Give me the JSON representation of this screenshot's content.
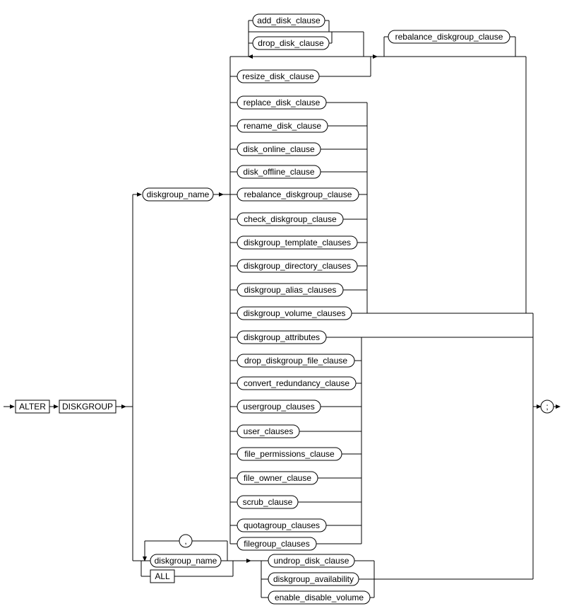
{
  "diagram": {
    "type": "railroad_syntax_diagram",
    "statement": "ALTER DISKGROUP",
    "keywords": {
      "alter": "ALTER",
      "diskgroup": "DISKGROUP",
      "all": "ALL",
      "semicolon": ";",
      "comma": ","
    },
    "nonterminals": {
      "diskgroup_name_1": "diskgroup_name",
      "diskgroup_name_2": "diskgroup_name",
      "add_disk_clause": "add_disk_clause",
      "drop_disk_clause": "drop_disk_clause",
      "resize_disk_clause": "resize_disk_clause",
      "rebalance_diskgroup_clause_top": "rebalance_diskgroup_clause",
      "replace_disk_clause": "replace_disk_clause",
      "rename_disk_clause": "rename_disk_clause",
      "disk_online_clause": "disk_online_clause",
      "disk_offline_clause": "disk_offline_clause",
      "rebalance_diskgroup_clause": "rebalance_diskgroup_clause",
      "check_diskgroup_clause": "check_diskgroup_clause",
      "diskgroup_template_clauses": "diskgroup_template_clauses",
      "diskgroup_directory_clauses": "diskgroup_directory_clauses",
      "diskgroup_alias_clauses": "diskgroup_alias_clauses",
      "diskgroup_volume_clauses": "diskgroup_volume_clauses",
      "diskgroup_attributes": "diskgroup_attributes",
      "drop_diskgroup_file_clause": "drop_diskgroup_file_clause",
      "convert_redundancy_clause": "convert_redundancy_clause",
      "usergroup_clauses": "usergroup_clauses",
      "user_clauses": "user_clauses",
      "file_permissions_clause": "file_permissions_clause",
      "file_owner_clause": "file_owner_clause",
      "scrub_clause": "scrub_clause",
      "quotagroup_clauses": "quotagroup_clauses",
      "filegroup_clauses": "filegroup_clauses",
      "undrop_disk_clause": "undrop_disk_clause",
      "diskgroup_availability": "diskgroup_availability",
      "enable_disable_volume": "enable_disable_volume"
    }
  }
}
